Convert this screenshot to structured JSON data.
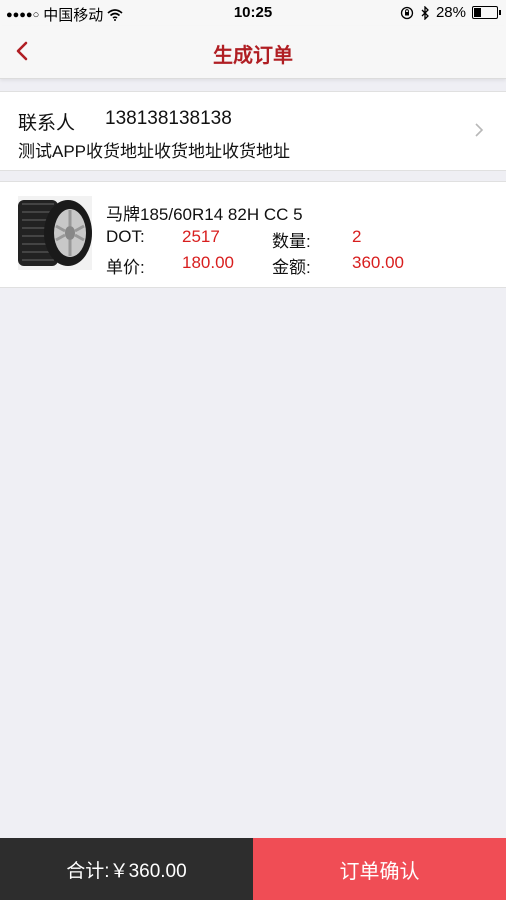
{
  "status_bar": {
    "signal": "●●●●○",
    "carrier": "中国移动",
    "time": "10:25",
    "battery_percent": "28%",
    "battery_level": 0.28
  },
  "nav": {
    "title": "生成订单"
  },
  "contact": {
    "label": "联系人",
    "phone": "138138138138",
    "address": "测试APP收货地址收货地址收货地址"
  },
  "product": {
    "name": "马牌185/60R14 82H CC 5",
    "dot_label": "DOT:",
    "dot_value": "2517",
    "qty_label": "数量:",
    "qty_value": "2",
    "price_label": "单价:",
    "price_value": "180.00",
    "amount_label": "金额:",
    "amount_value": "360.00"
  },
  "footer": {
    "total": "合计:￥360.00",
    "confirm_label": "订单确认"
  },
  "colors": {
    "title_red": "#b01e23",
    "value_red": "#d81e1e",
    "confirm_bg": "#f04d55",
    "total_bg": "#2d2d2d"
  }
}
